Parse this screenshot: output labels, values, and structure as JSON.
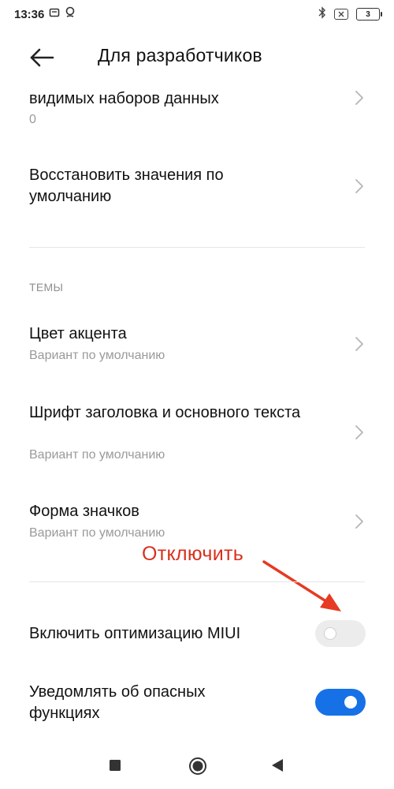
{
  "status_bar": {
    "time": "13:36",
    "battery": "3"
  },
  "header": {
    "title": "Для разработчиков"
  },
  "items": [
    {
      "title": "видимых наборов данных",
      "subtitle": "0"
    },
    {
      "title": "Восстановить значения по умолчанию",
      "subtitle": ""
    }
  ],
  "themes_section": {
    "header": "ТЕМЫ",
    "items": [
      {
        "title": "Цвет акцента",
        "subtitle": "Вариант по умолчанию"
      },
      {
        "title": "Шрифт заголовка и основного текста",
        "subtitle": "Вариант по умолчанию"
      },
      {
        "title": "Форма значков",
        "subtitle": "Вариант по умолчанию"
      }
    ]
  },
  "toggles": [
    {
      "title": "Включить оптимизацию MIUI",
      "state": "off"
    },
    {
      "title": "Уведомлять об опасных функциях",
      "state": "on"
    }
  ],
  "annotation": {
    "text": "Отключить",
    "color": "#d9301c"
  },
  "colors": {
    "accent": "#1771e6",
    "subtitle": "#9a9a9a"
  },
  "icons": [
    "back-arrow-icon",
    "chevron-right-icon",
    "bluetooth-icon",
    "sim-icon",
    "battery-icon",
    "recents-icon",
    "home-icon",
    "back-triangle-icon"
  ]
}
